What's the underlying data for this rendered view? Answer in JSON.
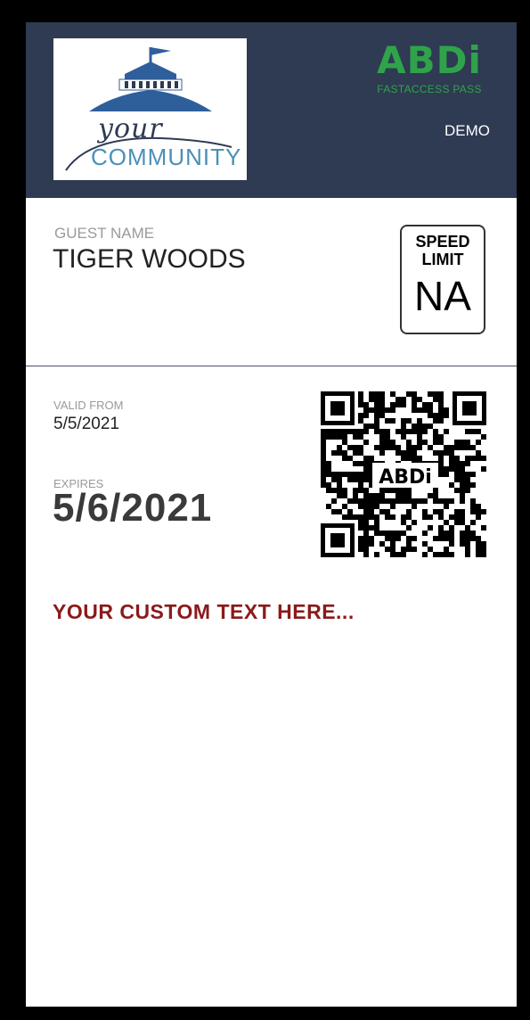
{
  "header": {
    "logo": {
      "text_your": "your",
      "text_community": "COMMUNITY"
    },
    "brand": {
      "name": "ABDi",
      "subtitle": "FASTACCESS PASS"
    },
    "mode": "DEMO"
  },
  "guest": {
    "label": "GUEST NAME",
    "name": "TIGER WOODS"
  },
  "speed_limit": {
    "title": "SPEED LIMIT",
    "value": "NA"
  },
  "validity": {
    "valid_from_label": "VALID FROM",
    "valid_from": "5/5/2021",
    "expires_label": "EXPIRES",
    "expires": "5/6/2021"
  },
  "qr": {
    "center_label": "ABDi"
  },
  "custom_text": "YOUR CUSTOM TEXT HERE...",
  "colors": {
    "header_bg": "#2f3a53",
    "brand_green": "#2fa34a",
    "custom_text": "#8b1a1a"
  }
}
